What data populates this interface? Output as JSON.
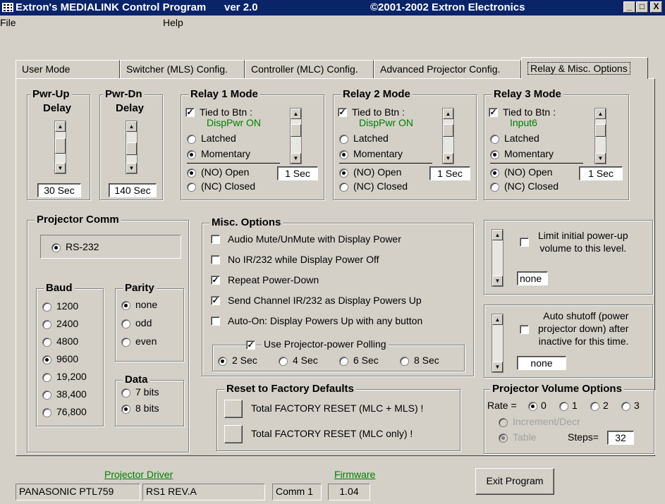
{
  "window": {
    "title": "Extron's MEDIALINK Control Program",
    "version": "ver 2.0",
    "copyright": "©2001-2002 Extron Electronics",
    "min": "_",
    "max": "□",
    "close": "X"
  },
  "menu": {
    "file": "File",
    "help": "Help"
  },
  "tabs": [
    "User Mode",
    "Switcher (MLS) Config.",
    "Controller (MLC) Config.",
    "Advanced Projector Config.",
    "Relay & Misc. Options"
  ],
  "pwr_up": {
    "title1": "Pwr-Up",
    "title2": "Delay",
    "value": "30 Sec"
  },
  "pwr_dn": {
    "title1": "Pwr-Dn",
    "title2": "Delay",
    "value": "140 Sec"
  },
  "relays": [
    {
      "title": "Relay 1 Mode",
      "tied_label": "Tied to Btn :",
      "tied_btn": "DispPwr ON",
      "tied_checked": true,
      "latched": "Latched",
      "momentary": "Momentary",
      "mode": "momentary",
      "no_open": "(NO) Open",
      "nc_closed": "(NC) Closed",
      "contact": "no",
      "duration": "1 Sec"
    },
    {
      "title": "Relay 2 Mode",
      "tied_label": "Tied to Btn :",
      "tied_btn": "DispPwr ON",
      "tied_checked": true,
      "latched": "Latched",
      "momentary": "Momentary",
      "mode": "momentary",
      "no_open": "(NO) Open",
      "nc_closed": "(NC) Closed",
      "contact": "no",
      "duration": "1 Sec"
    },
    {
      "title": "Relay 3 Mode",
      "tied_label": "Tied to Btn :",
      "tied_btn": "Input6",
      "tied_checked": true,
      "latched": "Latched",
      "momentary": "Momentary",
      "mode": "momentary",
      "no_open": "(NO) Open",
      "nc_closed": "(NC) Closed",
      "contact": "no",
      "duration": "1 Sec"
    }
  ],
  "projector_comm": {
    "title": "Projector Comm",
    "protocol": "RS-232"
  },
  "baud": {
    "title": "Baud",
    "options": [
      "1200",
      "2400",
      "4800",
      "9600",
      "19,200",
      "38,400",
      "76,800"
    ],
    "selected": "9600"
  },
  "parity": {
    "title": "Parity",
    "options": [
      "none",
      "odd",
      "even"
    ],
    "selected": "none"
  },
  "data_bits": {
    "title": "Data",
    "options": [
      "7 bits",
      "8 bits"
    ],
    "selected": "8 bits"
  },
  "misc": {
    "title": "Misc. Options",
    "options": [
      {
        "label": "Audio Mute/UnMute with Display Power",
        "checked": false
      },
      {
        "label": "No IR/232 while Display Power Off",
        "checked": false
      },
      {
        "label": "Repeat Power-Down",
        "checked": true
      },
      {
        "label": "Send Channel IR/232 as Display Powers Up",
        "checked": true
      },
      {
        "label": "Auto-On: Display Powers Up with any button",
        "checked": false
      }
    ],
    "polling_label": "Use Projector-power Polling",
    "polling_checked": true,
    "polling_options": [
      "2 Sec",
      "4 Sec",
      "6 Sec",
      "8 Sec"
    ],
    "polling_selected": "2 Sec"
  },
  "reset": {
    "title": "Reset to Factory Defaults",
    "all": "Total FACTORY RESET (MLC + MLS) !",
    "mlc": "Total FACTORY RESET (MLC only) !"
  },
  "volume_limit": {
    "label1": "Limit initial power-up",
    "label2": "volume to this level.",
    "value": "none",
    "checked": false
  },
  "auto_shutoff": {
    "label1": "Auto shutoff (power",
    "label2": "projector down) after",
    "label3": "inactive for this time.",
    "value": "none",
    "checked": false
  },
  "volume_options": {
    "title": "Projector Volume Options",
    "rate_label": "Rate =",
    "rates": [
      "0",
      "1",
      "2",
      "3"
    ],
    "rate_selected": "0",
    "increment": "Increment/Decr",
    "table": "Table",
    "steps_label": "Steps=",
    "steps": "32"
  },
  "status": {
    "driver_label": "Projector Driver",
    "driver": "PANASONIC PTL759",
    "driver2": "RS1 REV.A",
    "comm": "Comm 1",
    "firmware_label": "Firmware",
    "firmware": "1.04"
  },
  "exit": "Exit Program"
}
